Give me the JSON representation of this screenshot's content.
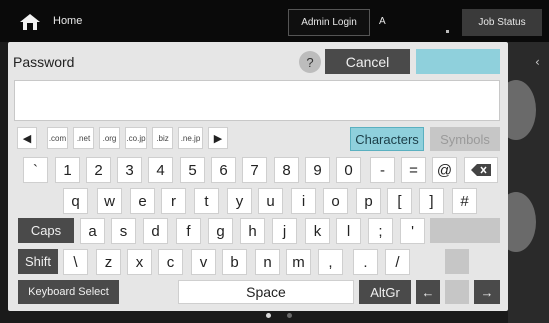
{
  "topbar": {
    "home_label": "Home",
    "admin_label": "Admin Login",
    "user_label": "A",
    "job_status_label": "Job Status"
  },
  "dialog": {
    "title": "Password",
    "help_label": "?",
    "cancel_label": "Cancel",
    "input_value": ""
  },
  "domains": [
    ".com",
    ".net",
    ".org",
    ".co.jp",
    ".biz",
    ".ne.jp"
  ],
  "mode": {
    "characters_label": "Characters",
    "symbols_label": "Symbols"
  },
  "row1": [
    "`",
    "1",
    "2",
    "3",
    "4",
    "5",
    "6",
    "7",
    "8",
    "9",
    "0",
    "-",
    "=",
    "@"
  ],
  "row2": [
    "q",
    "w",
    "e",
    "r",
    "t",
    "y",
    "u",
    "i",
    "o",
    "p",
    "[",
    "]",
    "#"
  ],
  "row3": [
    "a",
    "s",
    "d",
    "f",
    "g",
    "h",
    "j",
    "k",
    "l",
    ";",
    "'"
  ],
  "row4": [
    "\\",
    "z",
    "x",
    "c",
    "v",
    "b",
    "n",
    "m",
    ",",
    ".",
    "/"
  ],
  "labels": {
    "caps": "Caps",
    "shift": "Shift",
    "keyboard_select": "Keyboard Select",
    "space": "Space",
    "altgr": "AltGr",
    "left_arrow": "←",
    "right_arrow": "→"
  }
}
